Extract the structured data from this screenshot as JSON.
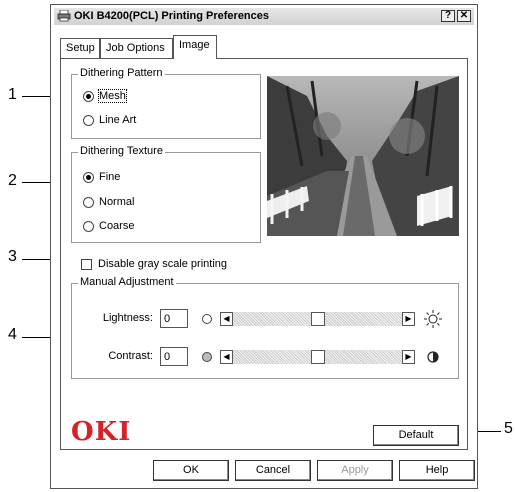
{
  "callouts": [
    "1",
    "2",
    "3",
    "4",
    "5"
  ],
  "window": {
    "title": "OKI B4200(PCL) Printing Preferences",
    "help_button": "?",
    "close_button": "✕"
  },
  "tabs": [
    {
      "label": "Setup",
      "active": false
    },
    {
      "label": "Job Options",
      "active": false
    },
    {
      "label": "Image",
      "active": true
    }
  ],
  "dithering_pattern": {
    "title": "Dithering Pattern",
    "options": [
      {
        "label": "Mesh",
        "checked": true
      },
      {
        "label": "Line Art",
        "checked": false
      }
    ]
  },
  "dithering_texture": {
    "title": "Dithering Texture",
    "options": [
      {
        "label": "Fine",
        "checked": true
      },
      {
        "label": "Normal",
        "checked": false
      },
      {
        "label": "Coarse",
        "checked": false
      }
    ]
  },
  "disable_gray": {
    "label": "Disable gray scale printing",
    "checked": false
  },
  "manual_adjustment": {
    "title": "Manual Adjustment",
    "lightness": {
      "label": "Lightness:",
      "value": "0",
      "slider_level": 0.5
    },
    "contrast": {
      "label": "Contrast:",
      "value": "0",
      "slider_level": 0.5
    }
  },
  "brand": {
    "logo": "OKI",
    "color": "#d52127"
  },
  "buttons": {
    "default": "Default",
    "ok": "OK",
    "cancel": "Cancel",
    "apply": "Apply",
    "help": "Help"
  }
}
